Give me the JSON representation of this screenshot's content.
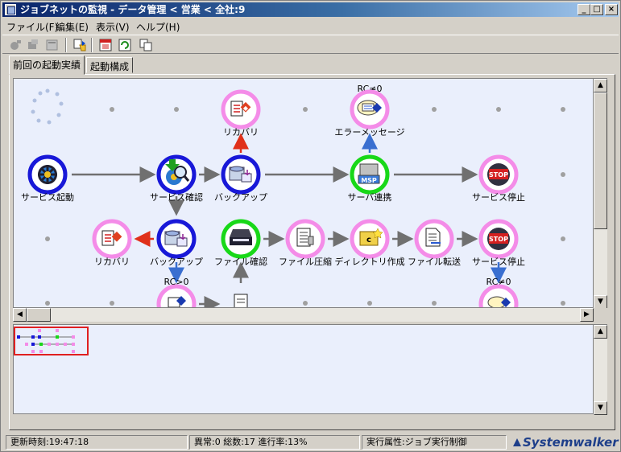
{
  "window": {
    "title": "ジョブネットの監視 - データ管理 < 営業 < 全社:9",
    "controls": [
      "_",
      "□",
      "×"
    ]
  },
  "menu": [
    "ファイル(F)",
    "編集(E)",
    "表示(V)",
    "ヘルプ(H)"
  ],
  "toolbar_icons": [
    "start-job-icon",
    "stop-job-icon",
    "properties-icon",
    "filter-icon",
    "calendar-icon",
    "refresh-icon",
    "copy-icon"
  ],
  "tabs": [
    {
      "label": "前回の起動実績",
      "active": true
    },
    {
      "label": "起動構成",
      "active": false
    }
  ],
  "colors": {
    "ring_blue": "#1818d8",
    "ring_green": "#18d818",
    "ring_pink": "#f48ce8",
    "arrow_gray": "#707070",
    "arrow_red": "#e0301a",
    "arrow_blue": "#3a6fd0",
    "canvas_bg": "#eaeffc"
  },
  "flow": {
    "nodes": [
      {
        "id": "service-start",
        "label": "サービス起動",
        "ring": "blue",
        "icon": "gear-icon"
      },
      {
        "id": "service-check",
        "label": "サービス確認",
        "ring": "blue",
        "icon": "magnifier-gear-icon"
      },
      {
        "id": "recovery-1",
        "label": "リカバリ",
        "ring": "pink",
        "icon": "recovery-icon"
      },
      {
        "id": "backup-1",
        "label": "バックアップ",
        "ring": "blue",
        "icon": "backup-icon"
      },
      {
        "id": "error-message",
        "label": "エラーメッセージ",
        "ring": "pink",
        "icon": "message-icon"
      },
      {
        "id": "server-link",
        "label": "サーバ連携",
        "ring": "green",
        "icon": "msp-icon"
      },
      {
        "id": "service-stop-1",
        "label": "サービス停止",
        "ring": "pink",
        "icon": "stop-icon"
      },
      {
        "id": "recovery-2",
        "label": "リカバリ",
        "ring": "pink",
        "icon": "recovery-icon"
      },
      {
        "id": "backup-2",
        "label": "バックアップ",
        "ring": "blue",
        "icon": "backup-icon"
      },
      {
        "id": "file-check",
        "label": "ファイル確認",
        "ring": "green",
        "icon": "scanner-icon"
      },
      {
        "id": "file-compress",
        "label": "ファイル圧縮",
        "ring": "pink",
        "icon": "document-icon"
      },
      {
        "id": "dir-create",
        "label": "ディレクトリ作成",
        "ring": "pink",
        "icon": "folder-c-icon"
      },
      {
        "id": "file-transfer",
        "label": "ファイル転送",
        "ring": "pink",
        "icon": "document-icon"
      },
      {
        "id": "service-stop-2",
        "label": "サービス停止",
        "ring": "pink",
        "icon": "stop-icon"
      },
      {
        "id": "msg-partial-1",
        "label": "",
        "ring": "pink",
        "icon": "message-icon"
      },
      {
        "id": "doc-partial-1",
        "label": "",
        "ring": "none",
        "icon": "document-icon"
      },
      {
        "id": "msg-partial-2",
        "label": "",
        "ring": "pink",
        "icon": "message-icon"
      }
    ],
    "conditions": {
      "error_message": "RC≠0",
      "backup_2": "RC>0",
      "service_stop_2": "RC≠0"
    }
  },
  "status": {
    "updated": "更新時刻:19:47:18",
    "counts": "異常:0 総数:17 進行率:13%",
    "attribute": "実行属性:ジョブ実行制御",
    "brand": "Systemwalker"
  }
}
